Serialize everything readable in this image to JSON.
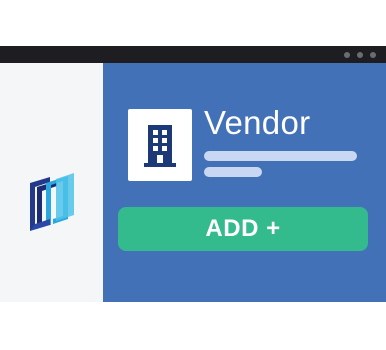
{
  "vendor_card": {
    "title": "Vendor",
    "icon": "building-icon",
    "add_button_label": "ADD +"
  },
  "brand": {
    "logo": "brand-logo-icon"
  },
  "window": {
    "controls": [
      "window-dot-icon",
      "window-dot-icon",
      "window-dot-icon"
    ]
  },
  "colors": {
    "titlebar": "#1e1e22",
    "sidebar": "#f5f6f8",
    "panel": "#4271b8",
    "placeholder": "#c9d8f2",
    "button": "#33bb8e",
    "text": "#ffffff"
  }
}
